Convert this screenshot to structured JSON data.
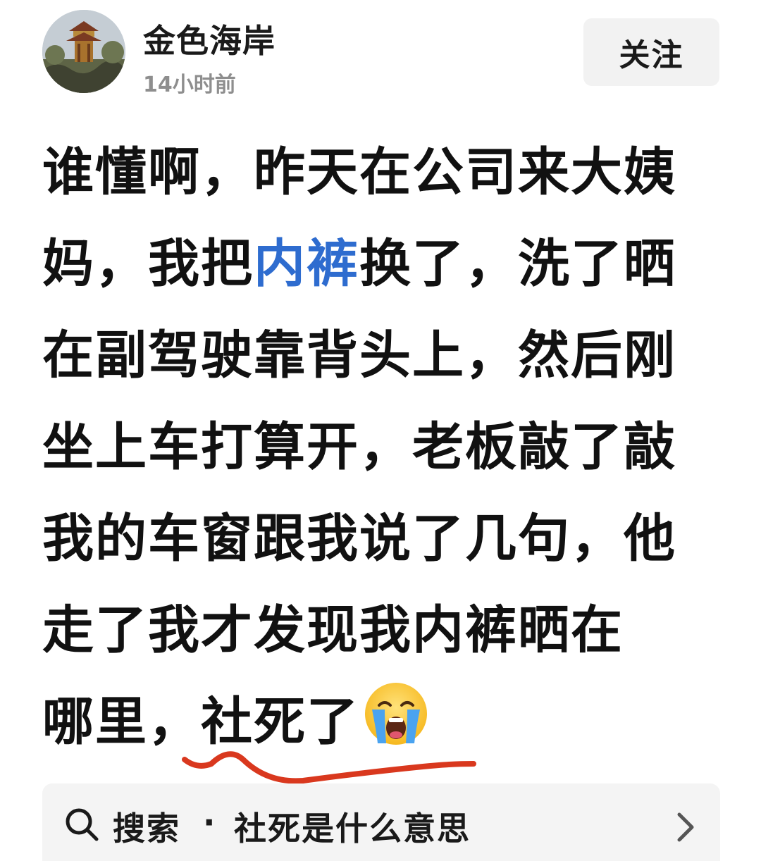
{
  "header": {
    "author_name": "金色海岸",
    "post_time": "14小时前",
    "follow_label": "关注"
  },
  "post": {
    "lines": [
      {
        "segments": [
          "谁懂啊，昨天在公司来大姨"
        ]
      },
      {
        "before": "妈，我把",
        "link": "内裤",
        "after": "换了，洗了晒"
      },
      {
        "segments": [
          "在副驾驶靠背头上，然后刚"
        ]
      },
      {
        "segments": [
          "坐上车打算开，老板敲了敲"
        ]
      },
      {
        "segments": [
          "我的车窗跟我说了几句，他"
        ]
      },
      {
        "segments": [
          "走了我才发现我内裤晒在"
        ]
      },
      {
        "before": "哪里，",
        "highlight": "社死了",
        "emoji": "loudly-crying-face"
      }
    ],
    "l1": "谁懂啊，昨天在公司来大姨",
    "l2_before": "妈，我把",
    "l2_link": "内裤",
    "l2_after": "换了，洗了晒",
    "l3": "在副驾驶靠背头上，然后刚",
    "l4": "坐上车打算开，老板敲了敲",
    "l5": "我的车窗跟我说了几句，他",
    "l6": "走了我才发现我内裤晒在",
    "l7_before": "哪里，",
    "l7_highlight": "社死了",
    "link_color": "#2e6ccf",
    "annotation_color": "#d9381e"
  },
  "search": {
    "label": "搜索",
    "separator": "·",
    "query": "社死是什么意思",
    "icon": "search-icon",
    "chevron": "chevron-right-icon"
  }
}
